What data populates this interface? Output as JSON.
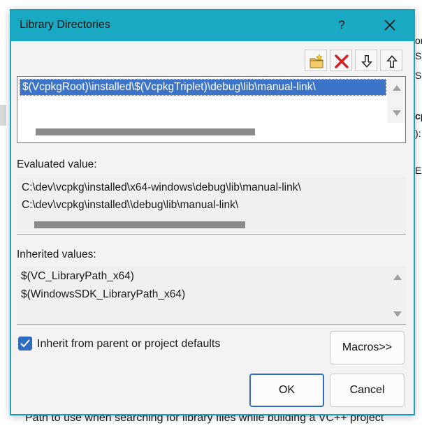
{
  "background": {
    "right_edge_fragments": [
      "or",
      "SI",
      "SI",
      "cp",
      "):",
      "Ex"
    ],
    "bottom_text": "Path to use when searching for library files while building a VC++ project"
  },
  "dialog": {
    "title": "Library Directories",
    "help_label": "?",
    "toolbar": {
      "icons": [
        "new-folder-icon",
        "delete-icon",
        "move-down-icon",
        "move-up-icon"
      ]
    },
    "directories": [
      "$(VcpkgRoot)\\installed\\$(VcpkgTriplet)\\debug\\lib\\manual-link\\"
    ],
    "evaluated": {
      "label": "Evaluated value:",
      "lines": [
        "C:\\dev\\vcpkg\\installed\\x64-windows\\debug\\lib\\manual-link\\",
        "C:\\dev\\vcpkg\\installed\\\\debug\\lib\\manual-link\\"
      ]
    },
    "inherited": {
      "label": "Inherited values:",
      "lines": [
        "$(VC_LibraryPath_x64)",
        "$(WindowsSDK_LibraryPath_x64)"
      ]
    },
    "inherit_checkbox": {
      "label": "Inherit from parent or project defaults",
      "checked": true
    },
    "buttons": {
      "macros": "Macros>>",
      "ok": "OK",
      "cancel": "Cancel"
    }
  },
  "colors": {
    "titlebar": "#1aa9c2",
    "selection": "#3b74c8",
    "accent": "#2f6cc0"
  }
}
